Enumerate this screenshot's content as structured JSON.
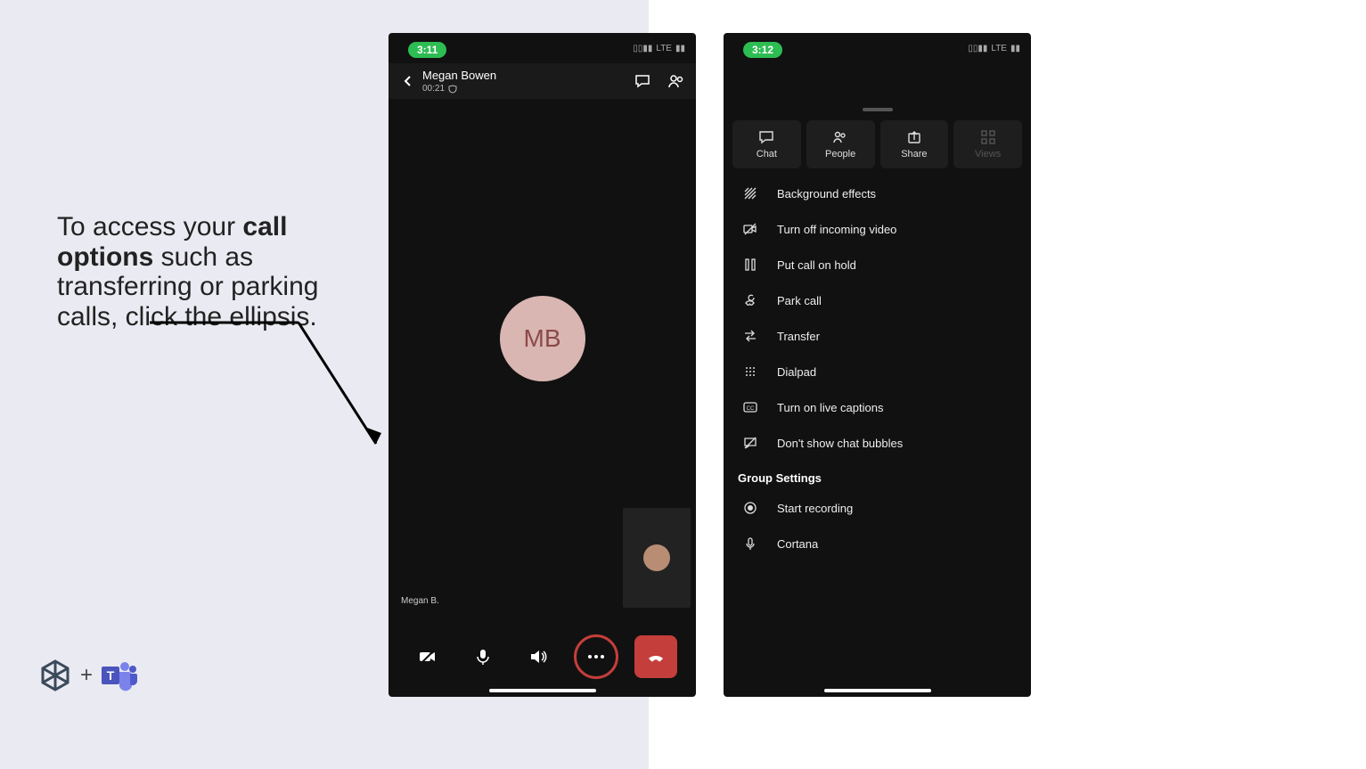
{
  "instruction": {
    "prefix": "To access your ",
    "bold": "call options",
    "rest": " such as transferring or parking calls, click the ellipsis."
  },
  "phone1": {
    "time": "3:11",
    "network": "LTE",
    "callee_name": "Megan Bowen",
    "duration": "00:21",
    "avatar_initials": "MB",
    "participant_label": "Megan B."
  },
  "phone2": {
    "time": "3:12",
    "network": "LTE",
    "top_actions": [
      {
        "label": "Chat",
        "dim": false
      },
      {
        "label": "People",
        "dim": false
      },
      {
        "label": "Share",
        "dim": false
      },
      {
        "label": "Views",
        "dim": true
      }
    ],
    "menu_items": [
      "Background effects",
      "Turn off incoming video",
      "Put call on hold",
      "Park call",
      "Transfer",
      "Dialpad",
      "Turn on live captions",
      "Don't show chat bubbles"
    ],
    "group_settings_label": "Group Settings",
    "group_items": [
      "Start recording",
      "Cortana"
    ]
  }
}
